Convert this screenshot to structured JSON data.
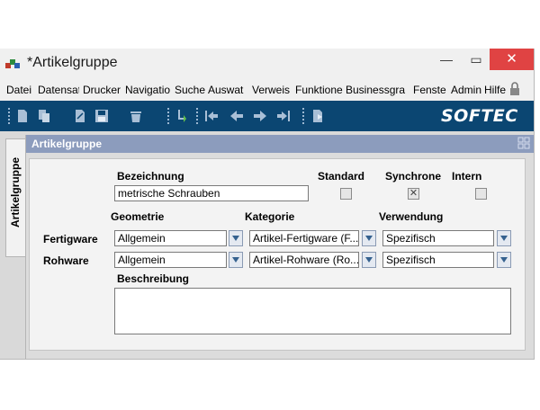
{
  "window": {
    "title": "*Artikelgruppe",
    "controls": {
      "minimize": "—",
      "maximize": "▭",
      "close": "✕"
    }
  },
  "menu": {
    "items": [
      "Datei",
      "Datensat",
      "Drucker",
      "Navigatio",
      "Suche",
      "Auswat",
      "Verweis",
      "Funktione",
      "Businessgra",
      "Fenste",
      "Admin",
      "Hilfe"
    ]
  },
  "toolbar": {
    "logo": "SOFTEC",
    "icons": [
      "new-document-icon",
      "copy-icon",
      "edit-icon",
      "save-icon",
      "delete-icon",
      "insert-icon",
      "first-record-icon",
      "previous-record-icon",
      "next-record-icon",
      "last-record-icon",
      "export-icon"
    ]
  },
  "side_tab": {
    "label": "Artikelgruppe"
  },
  "panel": {
    "title": "Artikelgruppe"
  },
  "form": {
    "bezeichnung_label": "Bezeichnung",
    "bezeichnung_value": "metrische Schrauben",
    "standard_label": "Standard",
    "standard_checked": false,
    "synchrone_label": "Synchrone",
    "synchrone_checked": true,
    "intern_label": "Intern",
    "intern_checked": false,
    "geometrie_label": "Geometrie",
    "kategorie_label": "Kategorie",
    "verwendung_label": "Verwendung",
    "rows": [
      {
        "label": "Fertigware",
        "geometrie": "Allgemein",
        "kategorie": "Artikel-Fertigware (F...",
        "verwendung": "Spezifisch"
      },
      {
        "label": "Rohware",
        "geometrie": "Allgemein",
        "kategorie": "Artikel-Rohware (Ro...",
        "verwendung": "Spezifisch"
      }
    ],
    "beschreibung_label": "Beschreibung",
    "beschreibung_value": ""
  },
  "colors": {
    "toolbar": "#0b4672",
    "panel_header": "#8c9cbd",
    "close_button": "#e04343",
    "dropdown_arrow": "#35618f"
  }
}
